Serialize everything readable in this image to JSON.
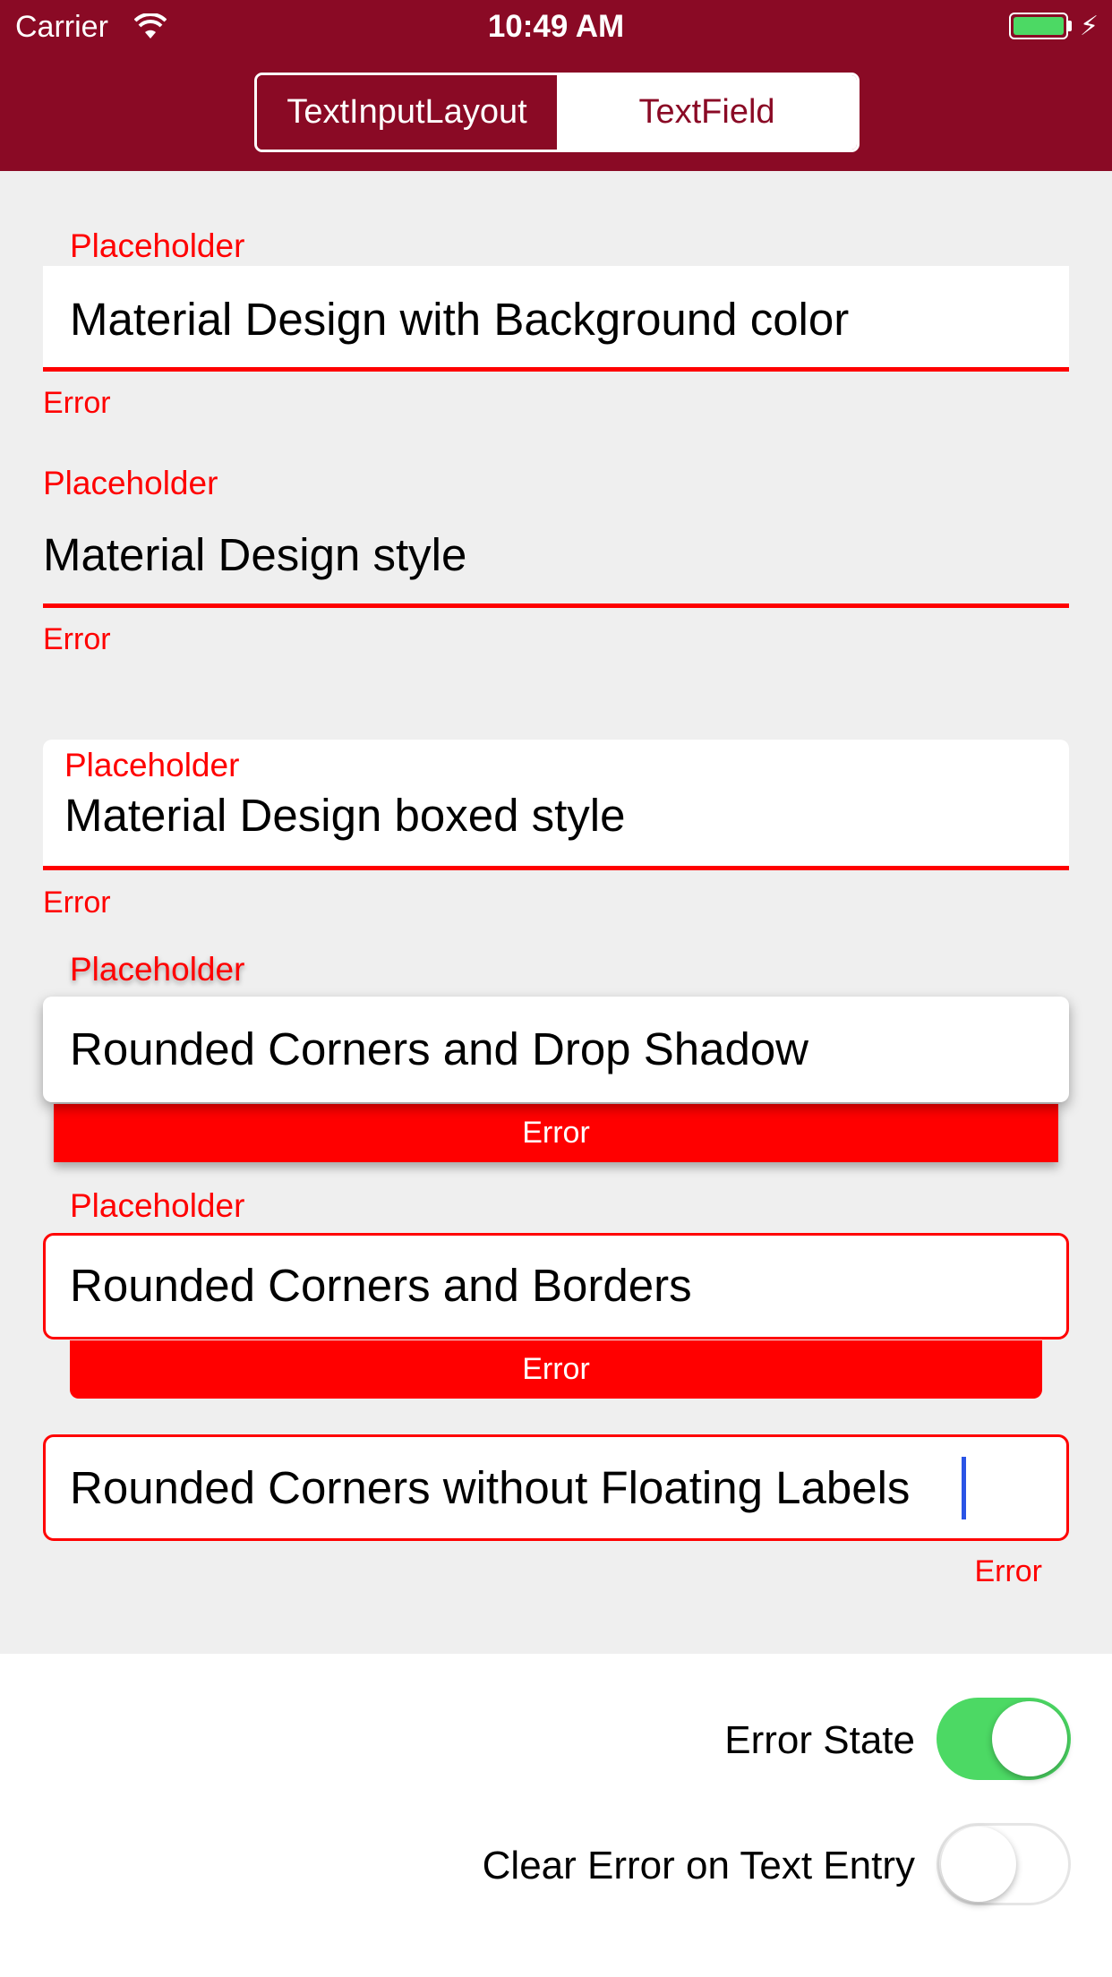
{
  "status_bar": {
    "carrier": "Carrier",
    "time": "10:49 AM",
    "battery_color": "#4cd964"
  },
  "header": {
    "background": "#8a0a25",
    "segments": [
      "TextInputLayout",
      "TextField"
    ],
    "selected_segment": "TextInputLayout"
  },
  "fields": [
    {
      "placeholder": "Placeholder",
      "value": "Material Design with Background color",
      "error": "Error"
    },
    {
      "placeholder": "Placeholder",
      "value": "Material Design style",
      "error": "Error"
    },
    {
      "placeholder": "Placeholder",
      "value": "Material Design boxed style",
      "error": "Error"
    },
    {
      "placeholder": "Placeholder",
      "value": "Rounded Corners and Drop Shadow",
      "error": "Error"
    },
    {
      "placeholder": "Placeholder",
      "value": "Rounded Corners and Borders",
      "error": "Error"
    },
    {
      "value": "Rounded Corners without Floating Labels",
      "error": "Error"
    }
  ],
  "error_color": "#ff0000",
  "options": [
    {
      "label": "Error State",
      "on": true
    },
    {
      "label": "Clear Error on Text Entry",
      "on": false
    }
  ]
}
